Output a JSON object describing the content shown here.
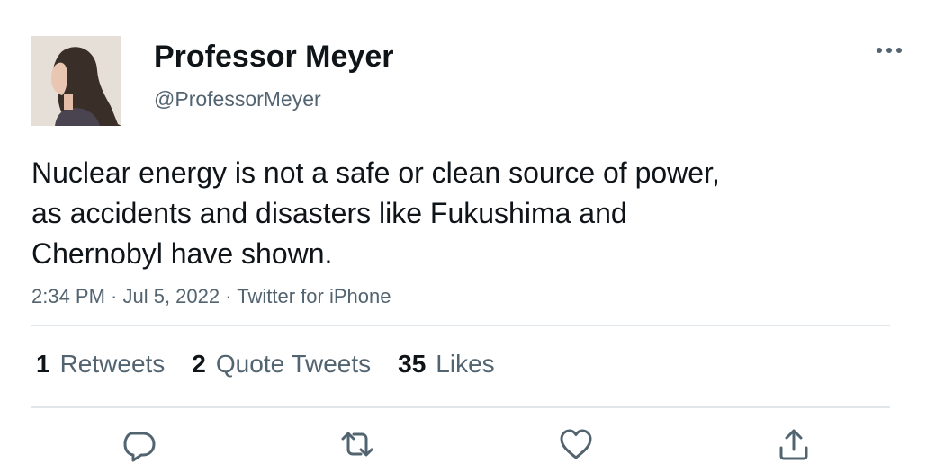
{
  "author": {
    "display_name": "Professor Meyer",
    "handle": "@ProfessorMeyer",
    "avatar_icon": "profile-photo"
  },
  "menu": {
    "icon": "more-options-icon"
  },
  "tweet": {
    "text_lines": [
      "Nuclear energy is not a safe or clean source of power,",
      "as accidents and disasters like Fukushima and",
      "Chernobyl have shown."
    ],
    "meta": "2:34 PM · Jul 5, 2022 · Twitter for iPhone"
  },
  "stats": [
    {
      "count": "1",
      "label": "Retweets"
    },
    {
      "count": "2",
      "label": "Quote Tweets"
    },
    {
      "count": "35",
      "label": "Likes"
    }
  ],
  "actions": [
    {
      "icon": "reply-icon"
    },
    {
      "icon": "retweet-icon"
    },
    {
      "icon": "like-icon"
    },
    {
      "icon": "share-icon"
    }
  ],
  "colors": {
    "text": "#0f1419",
    "secondary": "#536471",
    "divider": "#e1e6ea",
    "background": "#ffffff"
  }
}
